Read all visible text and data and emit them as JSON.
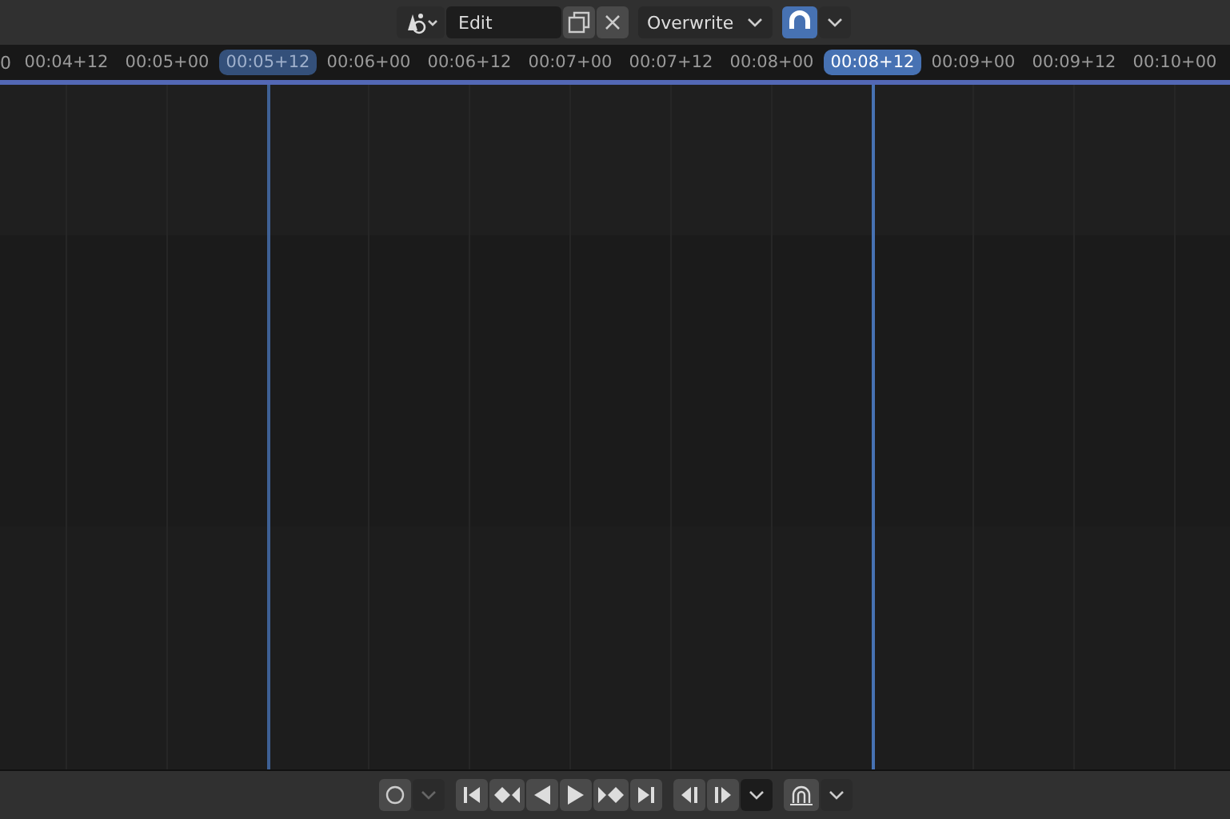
{
  "header": {
    "name_field": {
      "value": "Edit"
    },
    "mode_dropdown": {
      "value": "Overwrite"
    },
    "snap_toggle": {
      "on": true
    }
  },
  "ruler": {
    "edge_label": "0",
    "ticks": [
      {
        "label": "00:04+12",
        "kind": "tick"
      },
      {
        "label": "00:05+00",
        "kind": "tick"
      },
      {
        "label": "00:05+12",
        "kind": "playhead",
        "selected": false
      },
      {
        "label": "00:06+00",
        "kind": "tick"
      },
      {
        "label": "00:06+12",
        "kind": "tick"
      },
      {
        "label": "00:07+00",
        "kind": "tick"
      },
      {
        "label": "00:07+12",
        "kind": "tick"
      },
      {
        "label": "00:08+00",
        "kind": "tick"
      },
      {
        "label": "00:08+12",
        "kind": "playhead",
        "selected": true
      },
      {
        "label": "00:09+00",
        "kind": "tick"
      },
      {
        "label": "00:09+12",
        "kind": "tick"
      },
      {
        "label": "00:10+00",
        "kind": "tick"
      }
    ]
  },
  "footer": {
    "record": {
      "on": false
    },
    "record_menu": {
      "disabled": true
    },
    "auto_key": {
      "on": false
    }
  }
}
